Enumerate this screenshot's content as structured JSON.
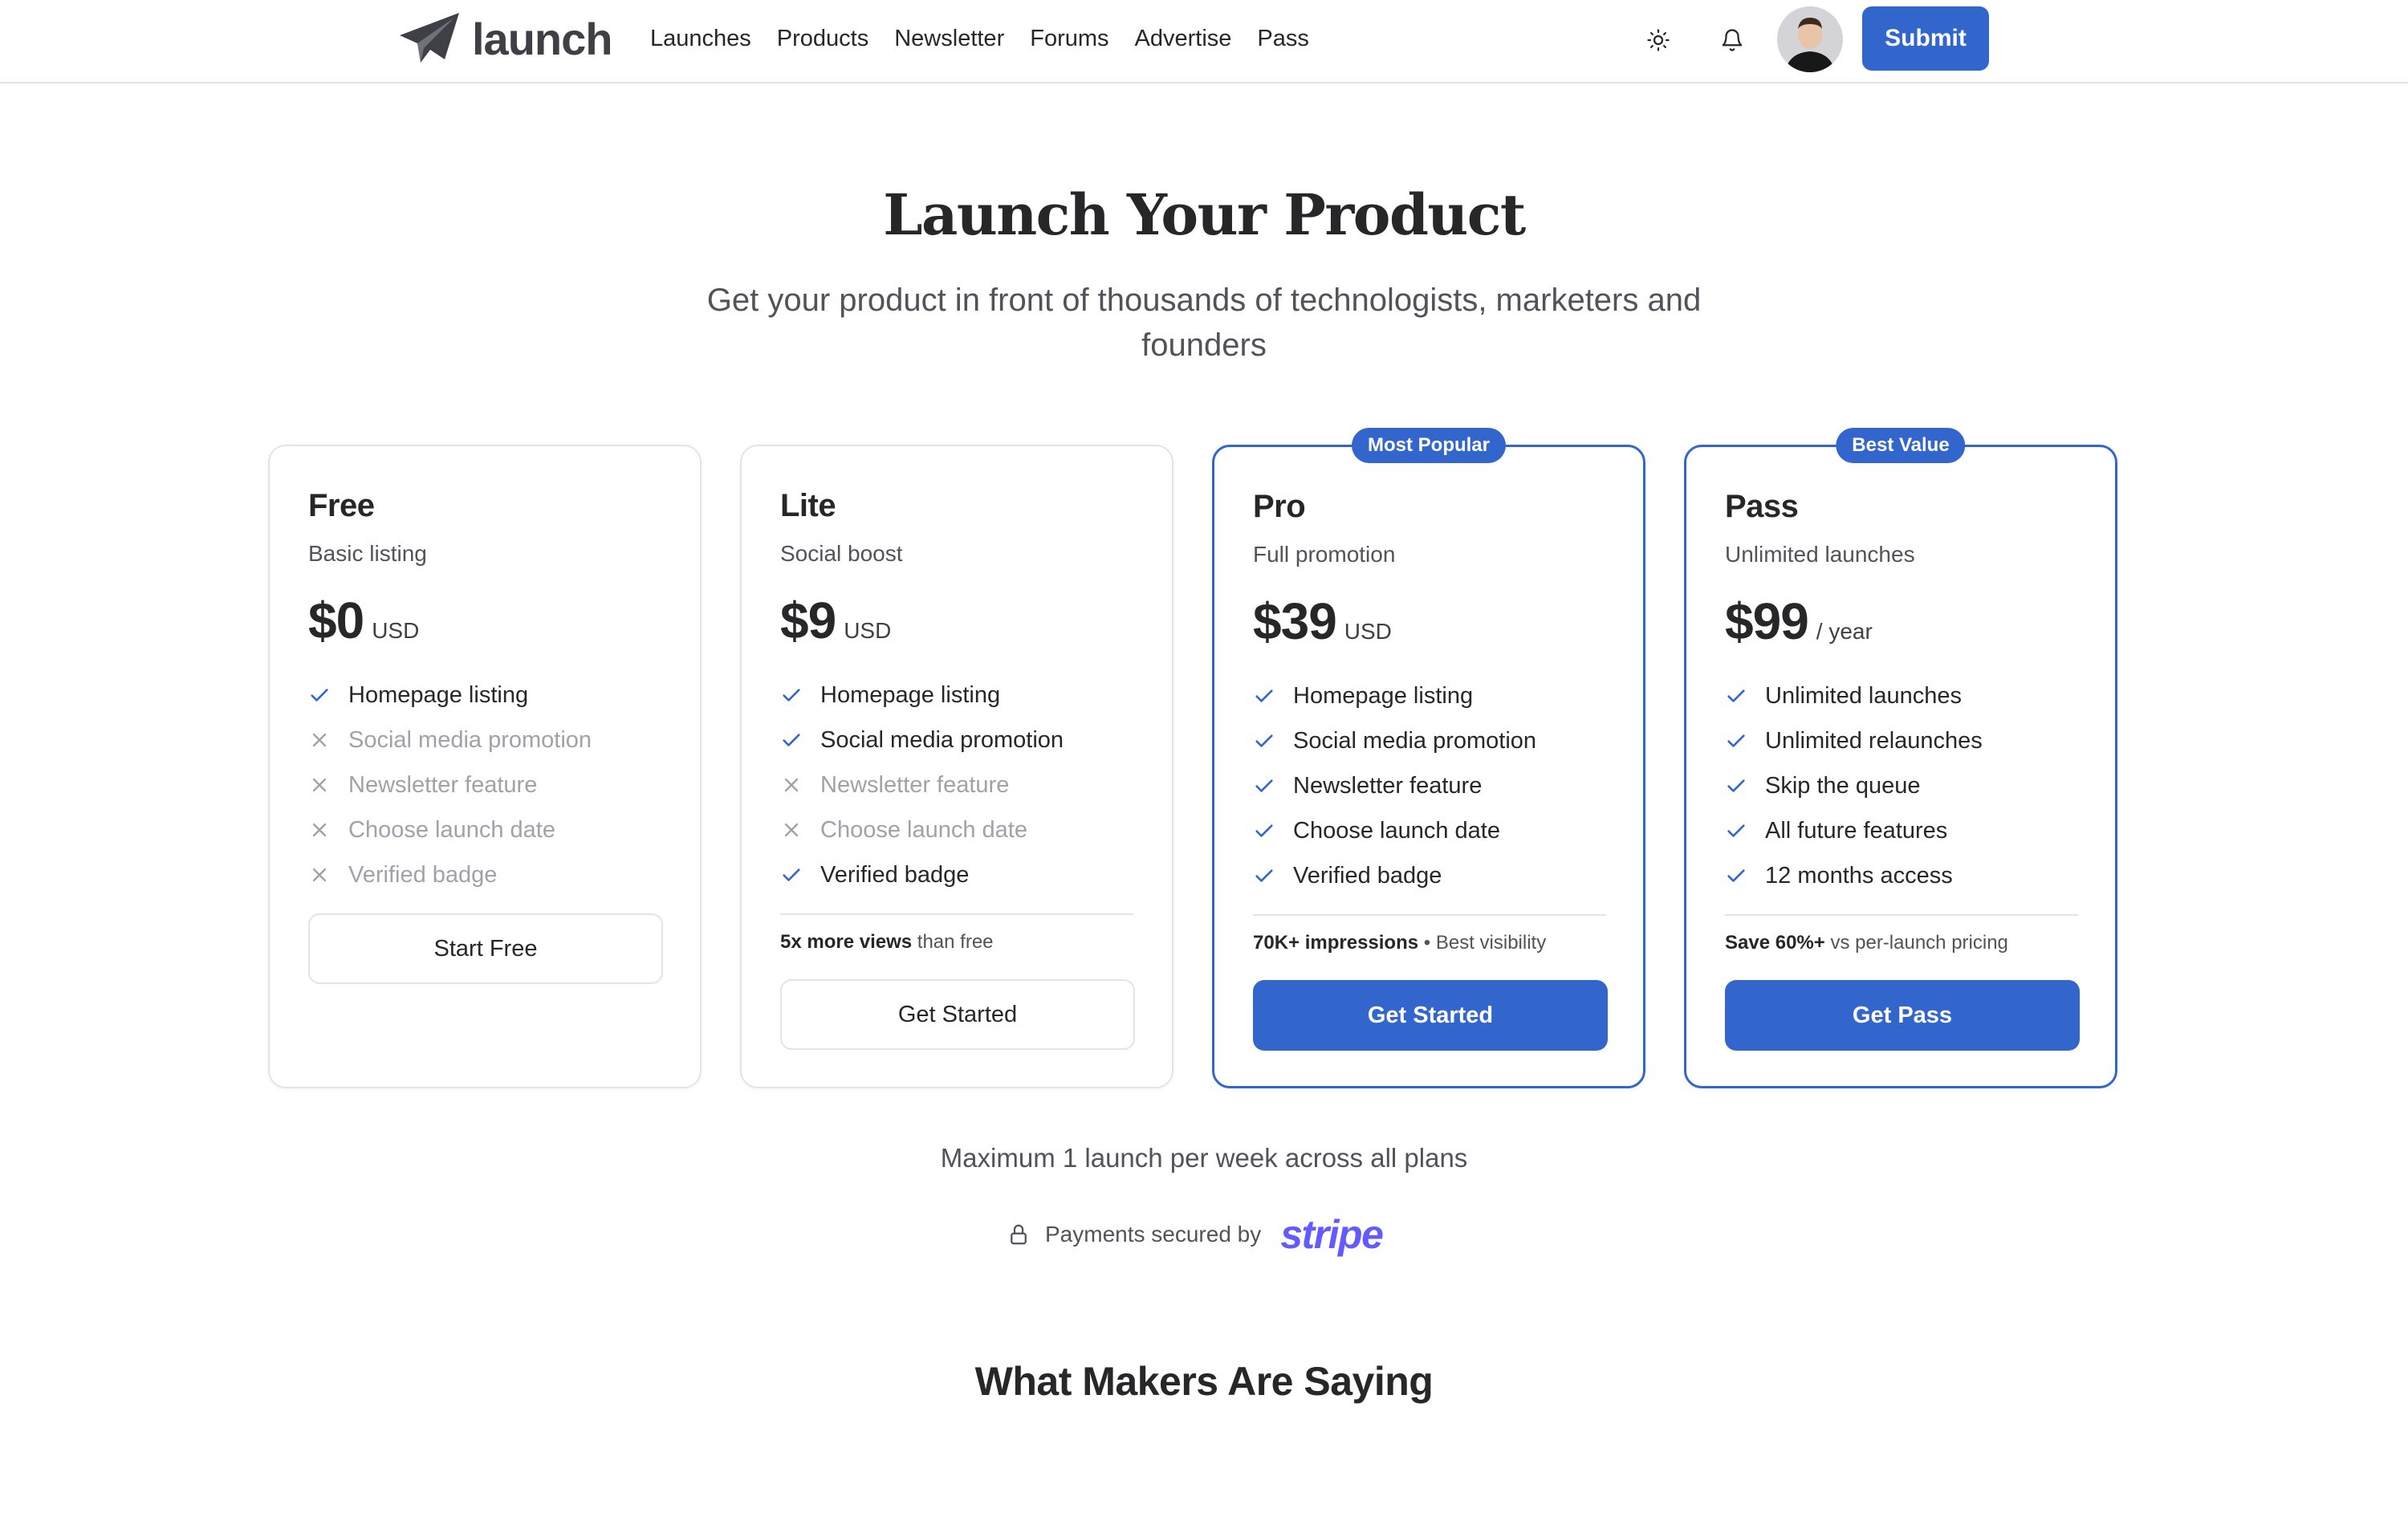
{
  "header": {
    "logo_text": "launch",
    "nav": [
      "Launches",
      "Products",
      "Newsletter",
      "Forums",
      "Advertise",
      "Pass"
    ],
    "submit_label": "Submit"
  },
  "hero": {
    "title": "Launch Your Product",
    "subtitle": "Get your product in front of thousands of technologists, marketers and founders"
  },
  "plans": [
    {
      "name": "Free",
      "description": "Basic listing",
      "price": "$0",
      "unit": "USD",
      "badge": "",
      "features": [
        {
          "label": "Homepage listing",
          "included": true
        },
        {
          "label": "Social media promotion",
          "included": false
        },
        {
          "label": "Newsletter feature",
          "included": false
        },
        {
          "label": "Choose launch date",
          "included": false
        },
        {
          "label": "Verified badge",
          "included": false
        }
      ],
      "note_bold": "",
      "note_rest": "",
      "cta": "Start Free"
    },
    {
      "name": "Lite",
      "description": "Social boost",
      "price": "$9",
      "unit": "USD",
      "badge": "",
      "features": [
        {
          "label": "Homepage listing",
          "included": true
        },
        {
          "label": "Social media promotion",
          "included": true
        },
        {
          "label": "Newsletter feature",
          "included": false
        },
        {
          "label": "Choose launch date",
          "included": false
        },
        {
          "label": "Verified badge",
          "included": true
        }
      ],
      "note_bold": "5x more views",
      "note_rest": " than free",
      "cta": "Get Started"
    },
    {
      "name": "Pro",
      "description": "Full promotion",
      "price": "$39",
      "unit": "USD",
      "badge": "Most Popular",
      "features": [
        {
          "label": "Homepage listing",
          "included": true
        },
        {
          "label": "Social media promotion",
          "included": true
        },
        {
          "label": "Newsletter feature",
          "included": true
        },
        {
          "label": "Choose launch date",
          "included": true
        },
        {
          "label": "Verified badge",
          "included": true
        }
      ],
      "note_bold": "70K+ impressions",
      "note_rest": " • Best visibility",
      "cta": "Get Started"
    },
    {
      "name": "Pass",
      "description": "Unlimited launches",
      "price": "$99",
      "unit": "/ year",
      "badge": "Best Value",
      "features": [
        {
          "label": "Unlimited launches",
          "included": true
        },
        {
          "label": "Unlimited relaunches",
          "included": true
        },
        {
          "label": "Skip the queue",
          "included": true
        },
        {
          "label": "All future features",
          "included": true
        },
        {
          "label": "12 months access",
          "included": true
        }
      ],
      "note_bold": "Save 60%+",
      "note_rest": " vs per-launch pricing",
      "cta": "Get Pass"
    }
  ],
  "limit_text": "Maximum 1 launch per week across all plans",
  "secure": {
    "text": "Payments secured by",
    "brand": "stripe"
  },
  "testimonials_title": "What Makers Are Saying",
  "colors": {
    "accent": "#3366cc",
    "stripe": "#635bff",
    "text": "#27272a",
    "muted": "#52525b",
    "disabled": "#a1a1aa",
    "border": "#e4e4e7"
  },
  "icons": {
    "logo": "paper-plane-icon",
    "theme": "sun-icon",
    "notifications": "bell-icon",
    "included": "check-icon",
    "excluded": "x-icon",
    "secure": "lock-icon"
  }
}
